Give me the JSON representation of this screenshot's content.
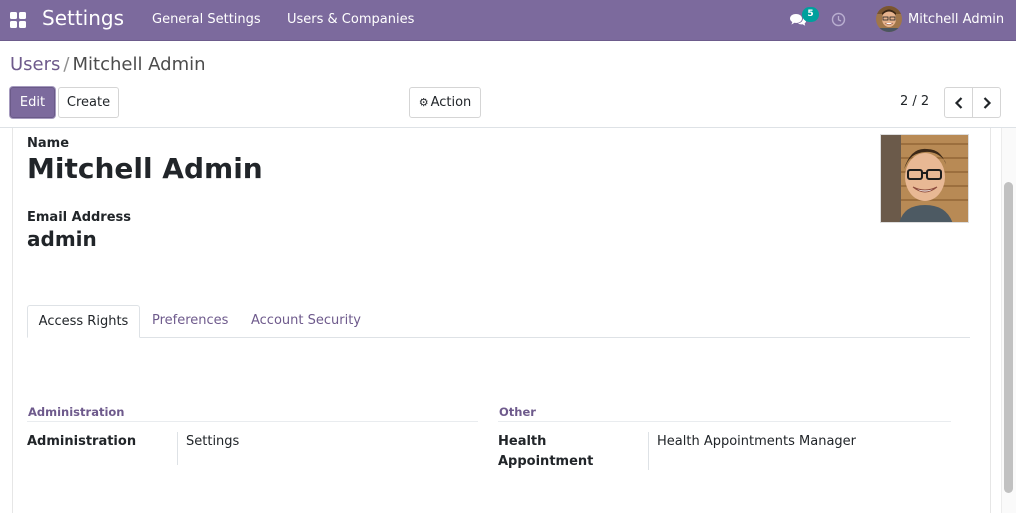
{
  "navbar": {
    "brand": "Settings",
    "menu": [
      "General Settings",
      "Users & Companies"
    ],
    "chat_badge": "5",
    "user_name": "Mitchell Admin",
    "background": "#7c6a9d"
  },
  "control_panel": {
    "breadcrumb_parent": "Users",
    "breadcrumb_separator": "/",
    "breadcrumb_current": "Mitchell Admin",
    "edit_label": "Edit",
    "create_label": "Create",
    "action_label": "Action",
    "pager_value": "2 / 2"
  },
  "form": {
    "name_label": "Name",
    "name_value": "Mitchell Admin",
    "email_label": "Email Address",
    "email_value": "admin"
  },
  "tabs": [
    {
      "label": "Access Rights",
      "active": true
    },
    {
      "label": "Preferences",
      "active": false
    },
    {
      "label": "Account Security",
      "active": false
    }
  ],
  "access_rights": {
    "groups": [
      {
        "title": "Administration",
        "fields": [
          {
            "label": "Administration",
            "value": "Settings"
          }
        ]
      },
      {
        "title": "Other",
        "fields": [
          {
            "label": "Health Appointment",
            "value": "Health Appointments Manager"
          }
        ]
      }
    ]
  },
  "icons": {
    "apps": "apps-grid-icon",
    "chat": "chat-icon",
    "activity": "clock-icon",
    "action_gear": "gear-icon",
    "prev": "chevron-left-icon",
    "next": "chevron-right-icon"
  },
  "colors": {
    "accent": "#7c6a9d",
    "link": "#6e5a8c",
    "badge": "#00a09d"
  }
}
